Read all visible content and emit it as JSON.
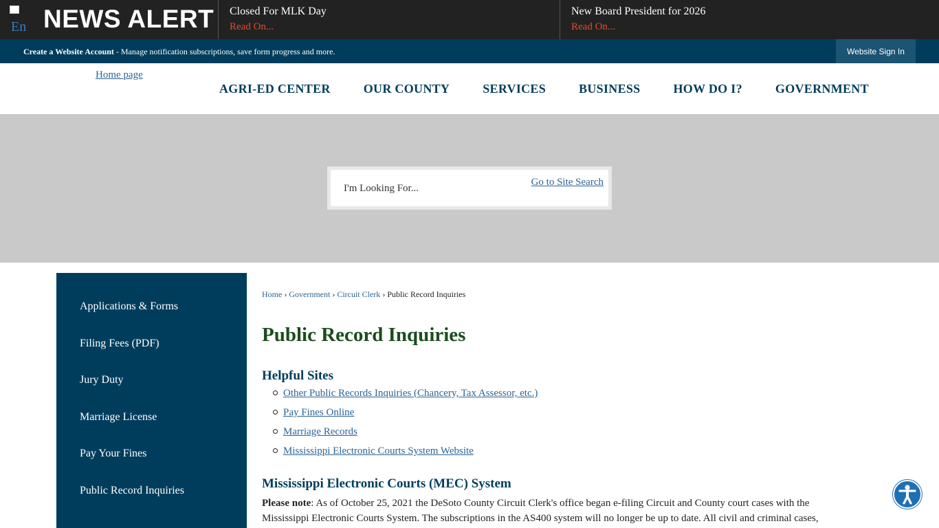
{
  "alert": {
    "logo_alt": "En",
    "title": "NEWS ALERT",
    "items": [
      {
        "headline": "Closed For MLK Day",
        "link": "Read On..."
      },
      {
        "headline": "New Board President for 2026",
        "link": "Read On..."
      }
    ]
  },
  "account": {
    "create_label": "Create a Website Account",
    "create_desc": " - Manage notification subscriptions, save form progress and more.",
    "signin_label": "Website Sign In"
  },
  "header": {
    "home_alt": "Home page",
    "nav": [
      "AGRI-ED CENTER",
      "OUR COUNTY",
      "SERVICES",
      "BUSINESS",
      "HOW DO I?",
      "GOVERNMENT"
    ]
  },
  "search": {
    "placeholder": "I'm Looking For...",
    "go_alt": "Go to Site Search"
  },
  "sidebar": {
    "items": [
      "Applications & Forms",
      "Filing Fees (PDF)",
      "Jury Duty",
      "Marriage License",
      "Pay Your Fines",
      "Public Record Inquiries"
    ]
  },
  "breadcrumb": {
    "home": "Home",
    "government": "Government",
    "circuit_clerk": "Circuit Clerk",
    "current": "Public Record Inquiries",
    "separator": "›"
  },
  "page": {
    "title": "Public Record Inquiries",
    "helpful_heading": "Helpful Sites",
    "links": [
      "Other Public Records Inquiries (Chancery, Tax Assessor, etc.)",
      "Pay Fines Online",
      "Marriage Records ",
      "Mississippi Electronic Courts System Website"
    ],
    "mec_heading": "Mississippi Electronic Courts (MEC) System",
    "note_label": "Please note",
    "note_text": ": As of October 25, 2021 the DeSoto County Circuit Clerk's office began e-filing Circuit and County court cases with the Mississippi Electronic Courts System. The subscriptions in the AS400 system will no longer be up to date.   All civil and criminal cases,"
  },
  "colors": {
    "navy": "#003d5c",
    "alert_bg": "#222222",
    "read_on": "#e14b2a",
    "title_green": "#1b4d1b",
    "link_blue": "#2a6496",
    "a11y_blue": "#1f6fb5"
  },
  "icons": {
    "accessibility": "accessibility-person-icon"
  }
}
